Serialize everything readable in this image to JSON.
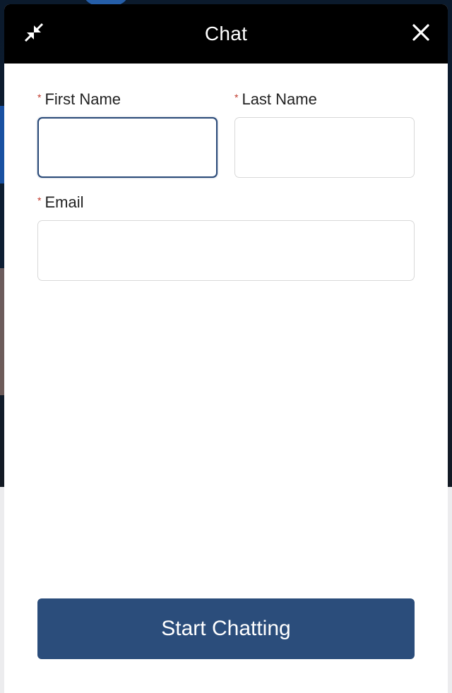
{
  "header": {
    "title": "Chat",
    "minimize_icon": "minimize-arrows-icon",
    "close_icon": "close-icon"
  },
  "form": {
    "first_name": {
      "label": "First Name",
      "required_marker": "*",
      "value": "",
      "focused": true
    },
    "last_name": {
      "label": "Last Name",
      "required_marker": "*",
      "value": ""
    },
    "email": {
      "label": "Email",
      "required_marker": "*",
      "value": ""
    }
  },
  "actions": {
    "start_label": "Start Chatting"
  },
  "colors": {
    "header_bg": "#000000",
    "button_bg": "#2b4d7b",
    "required": "#c0392b",
    "focus_border": "#2a4a78"
  }
}
